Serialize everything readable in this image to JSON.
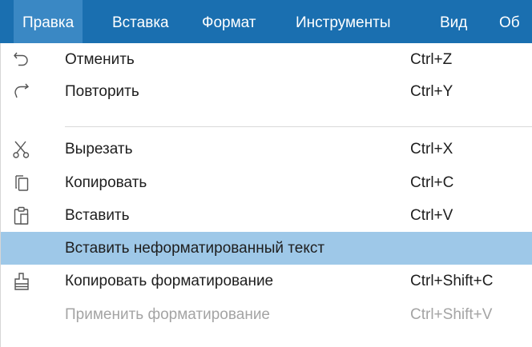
{
  "menubar": {
    "items": [
      {
        "label": "Правка",
        "active": true
      },
      {
        "label": "Вставка"
      },
      {
        "label": "Формат"
      },
      {
        "label": "Инструменты"
      },
      {
        "label": "Вид"
      },
      {
        "label": "Об"
      }
    ]
  },
  "menu": {
    "items": [
      {
        "label": "Отменить",
        "shortcut": "Ctrl+Z",
        "icon": "undo-icon"
      },
      {
        "label": "Повторить",
        "shortcut": "Ctrl+Y",
        "icon": "redo-icon"
      },
      {
        "label": "Вырезать",
        "shortcut": "Ctrl+X",
        "icon": "scissors-icon"
      },
      {
        "label": "Копировать",
        "shortcut": "Ctrl+C",
        "icon": "copy-icon"
      },
      {
        "label": "Вставить",
        "shortcut": "Ctrl+V",
        "icon": "paste-icon"
      },
      {
        "label": "Вставить неформатированный текст",
        "shortcut": "",
        "highlighted": true
      },
      {
        "label": "Копировать форматирование",
        "shortcut": "Ctrl+Shift+C",
        "icon": "format-painter-icon"
      },
      {
        "label": "Применить форматирование",
        "shortcut": "Ctrl+Shift+V",
        "disabled": true
      }
    ]
  },
  "colors": {
    "menubar_bg": "#1a6fb0",
    "menubar_active": "#3a88c4",
    "highlight": "#9ec8e8",
    "disabled_text": "#a4a4a4"
  }
}
